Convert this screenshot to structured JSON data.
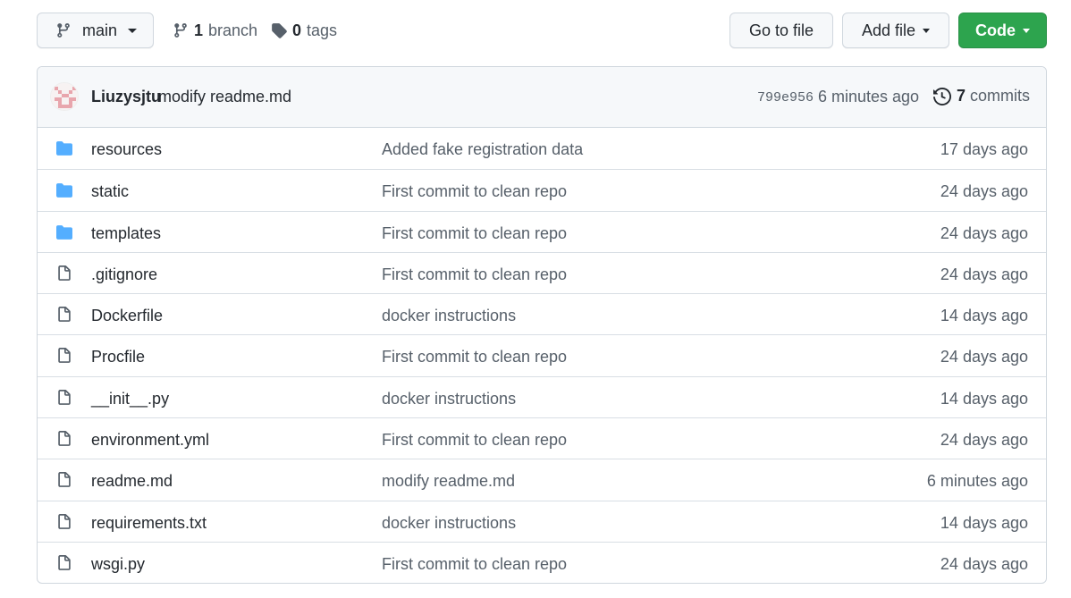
{
  "toolbar": {
    "branch_label": "main",
    "branches_count": "1",
    "branches_label": "branch",
    "tags_count": "0",
    "tags_label": "tags",
    "goto_label": "Go to file",
    "addfile_label": "Add file",
    "code_label": "Code"
  },
  "colors": {
    "code_button": "#2da44e",
    "folder_icon": "#54aeff",
    "file_icon": "#57606a"
  },
  "latest_commit": {
    "author": "Liuzysjtu",
    "message": "modify readme.md",
    "sha": "799e956",
    "time": "6 minutes ago",
    "commits_count": "7",
    "commits_label": "commits"
  },
  "files": [
    {
      "type": "folder",
      "icon": "folder-icon",
      "name": "resources",
      "commit": "Added fake registration data",
      "age": "17 days ago"
    },
    {
      "type": "folder",
      "icon": "folder-icon",
      "name": "static",
      "commit": "First commit to clean repo",
      "age": "24 days ago"
    },
    {
      "type": "folder",
      "icon": "folder-icon",
      "name": "templates",
      "commit": "First commit to clean repo",
      "age": "24 days ago"
    },
    {
      "type": "file",
      "icon": "file-icon",
      "name": ".gitignore",
      "commit": "First commit to clean repo",
      "age": "24 days ago"
    },
    {
      "type": "file",
      "icon": "file-icon",
      "name": "Dockerfile",
      "commit": "docker instructions",
      "age": "14 days ago"
    },
    {
      "type": "file",
      "icon": "file-icon",
      "name": "Procfile",
      "commit": "First commit to clean repo",
      "age": "24 days ago"
    },
    {
      "type": "file",
      "icon": "file-icon",
      "name": "__init__.py",
      "commit": "docker instructions",
      "age": "14 days ago"
    },
    {
      "type": "file",
      "icon": "file-icon",
      "name": "environment.yml",
      "commit": "First commit to clean repo",
      "age": "24 days ago"
    },
    {
      "type": "file",
      "icon": "file-icon",
      "name": "readme.md",
      "commit": "modify readme.md",
      "age": "6 minutes ago"
    },
    {
      "type": "file",
      "icon": "file-icon",
      "name": "requirements.txt",
      "commit": "docker instructions",
      "age": "14 days ago"
    },
    {
      "type": "file",
      "icon": "file-icon",
      "name": "wsgi.py",
      "commit": "First commit to clean repo",
      "age": "24 days ago"
    }
  ]
}
